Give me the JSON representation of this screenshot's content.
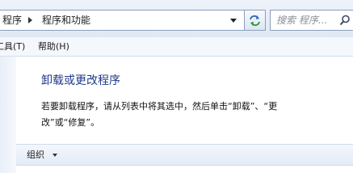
{
  "address_bar": {
    "breadcrumbs": [
      "程序",
      "程序和功能"
    ],
    "search_placeholder": "搜索 程序..."
  },
  "menu": {
    "items": [
      "工具(T)",
      "帮助(H)"
    ]
  },
  "main": {
    "title": "卸载或更改程序",
    "description_line1": "若要卸载程序，请从列表中将其选中，然后单击“卸载”、“更",
    "description_line2": "改”或“修复”。"
  },
  "toolbar": {
    "organize_label": "组织"
  }
}
